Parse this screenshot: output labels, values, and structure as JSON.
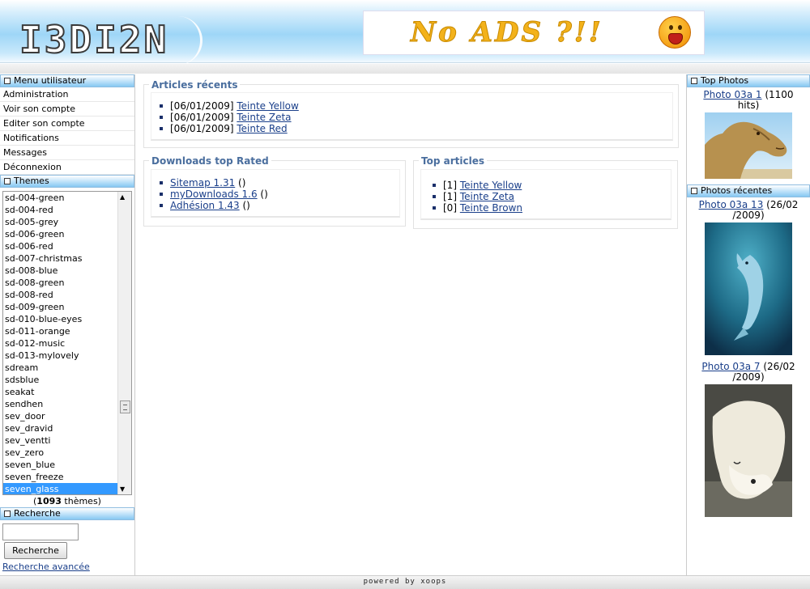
{
  "header": {
    "logo_text": "I3DI2N",
    "banner_text": "No ADS ?!!",
    "banner_icon": "screaming-smiley"
  },
  "left": {
    "user_menu_title": "Menu utilisateur",
    "user_menu": [
      "Administration",
      "Voir son compte",
      "Editer son compte",
      "Notifications",
      "Messages",
      "Déconnexion"
    ],
    "themes_title": "Themes",
    "themes": [
      "sd-004-green",
      "sd-004-red",
      "sd-005-grey",
      "sd-006-green",
      "sd-006-red",
      "sd-007-christmas",
      "sd-008-blue",
      "sd-008-green",
      "sd-008-red",
      "sd-009-green",
      "sd-010-blue-eyes",
      "sd-011-orange",
      "sd-012-music",
      "sd-013-mylovely",
      "sdream",
      "sdsblue",
      "seakat",
      "sendhen",
      "sev_door",
      "sev_dravid",
      "sev_ventti",
      "sev_zero",
      "seven_blue",
      "seven_freeze",
      "seven_glass"
    ],
    "themes_selected": "seven_glass",
    "theme_count_prefix": "(",
    "theme_count": "1093",
    "theme_count_suffix": " thèmes)",
    "search_title": "Recherche",
    "search_value": "",
    "search_button": "Recherche",
    "advanced_search": "Recherche avancée"
  },
  "center": {
    "recent_title": "Articles récents",
    "recent": [
      {
        "date": "[06/01/2009] ",
        "link": "Teinte Yellow"
      },
      {
        "date": "[06/01/2009] ",
        "link": "Teinte Zeta"
      },
      {
        "date": "[06/01/2009] ",
        "link": "Teinte Red"
      }
    ],
    "downloads_title": "Downloads top Rated",
    "downloads": [
      {
        "link": "Sitemap 1.31",
        "suffix": " ()"
      },
      {
        "link": "myDownloads 1.6",
        "suffix": " ()"
      },
      {
        "link": "Adhésion 1.43",
        "suffix": " ()"
      }
    ],
    "top_title": "Top articles",
    "top": [
      {
        "count": "[1] ",
        "link": "Teinte Yellow"
      },
      {
        "count": "[1] ",
        "link": "Teinte Zeta"
      },
      {
        "count": "[0] ",
        "link": "Teinte Brown"
      }
    ]
  },
  "right": {
    "top_photos_title": "Top Photos",
    "top_photo": {
      "link": "Photo 03a 1",
      "info_1": " (1100",
      "info_2": "hits)"
    },
    "recent_photos_title": "Photos récentes",
    "recent_photos": [
      {
        "link": "Photo 03a 13",
        "info_1": " (26/02",
        "info_2": "/2009)"
      },
      {
        "link": "Photo 03a 7",
        "info_1": " (26/02",
        "info_2": "/2009)"
      }
    ]
  },
  "footer": {
    "text": "powered by xoops"
  },
  "colors": {
    "accent": "#86c8f2",
    "link": "#1a3f8a",
    "legend": "#4a6e9e",
    "selection": "#3399ff"
  }
}
